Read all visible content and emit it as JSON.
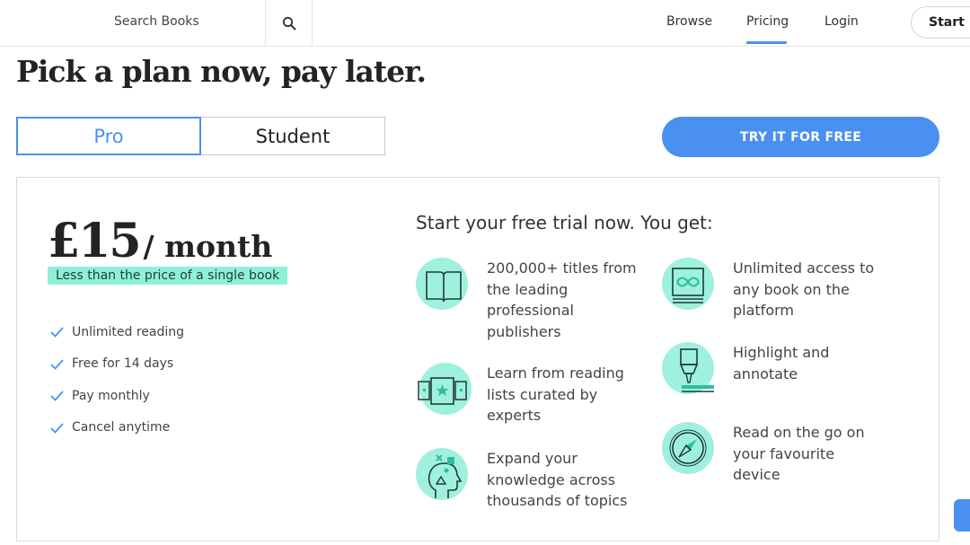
{
  "nav": {
    "search_placeholder": "Search Books",
    "links": [
      "Browse",
      "Pricing",
      "Login"
    ],
    "active_link": "Pricing",
    "start_label": "Start Fr"
  },
  "headline": "Pick a plan now, pay later.",
  "plans": {
    "pro": "Pro",
    "student": "Student",
    "selected": "Pro"
  },
  "cta": "TRY IT FOR FREE",
  "price": {
    "amount": "£15",
    "period": "/ month",
    "note": "Less than the price of a single book"
  },
  "features": [
    "Unlimited reading",
    "Free for 14 days",
    "Pay monthly",
    "Cancel anytime"
  ],
  "benefits_title": "Start your free trial now. You get:",
  "benefits": [
    {
      "icon": "open-book-icon",
      "text": "200,000+ titles from the leading professional publishers"
    },
    {
      "icon": "reading-list-icon",
      "text": "Learn from reading lists curated by experts"
    },
    {
      "icon": "head-knowledge-icon",
      "text": "Expand your knowledge across thousands of topics"
    },
    {
      "icon": "infinity-book-icon",
      "text": "Unlimited access to any book on the platform"
    },
    {
      "icon": "highlighter-icon",
      "text": "Highlight and annotate"
    },
    {
      "icon": "compass-icon",
      "text": "Read on the go on your favourite device"
    }
  ],
  "colors": {
    "accent": "#4a90f0",
    "mint": "#9ff0dd",
    "highlight": "#8ff0d8"
  }
}
